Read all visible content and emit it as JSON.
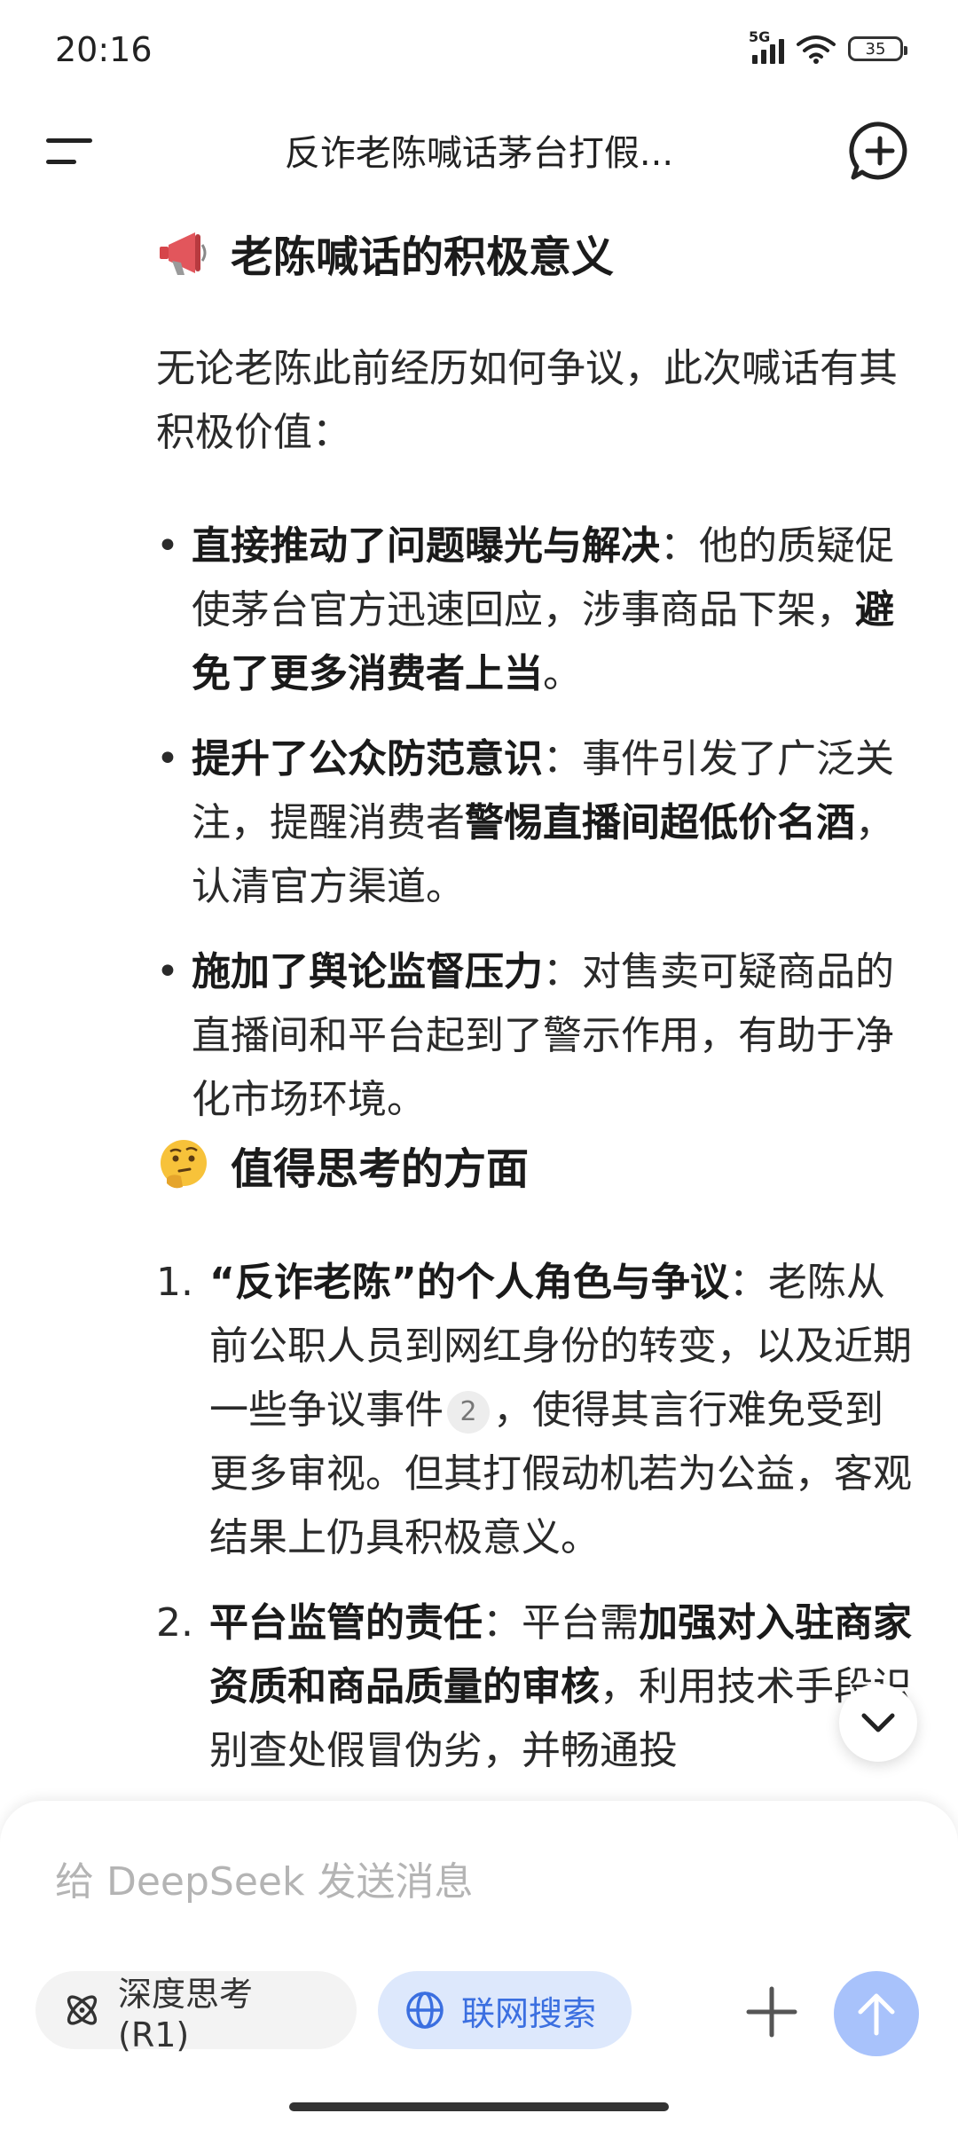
{
  "status_bar": {
    "time": "20:16",
    "network": "5G",
    "battery": "35"
  },
  "header": {
    "title": "反诈老陈喊话茅台打假..."
  },
  "section1": {
    "emoji": "megaphone-emoji",
    "heading": "老陈喊话的积极意义",
    "intro": "无论老陈此前经历如何争议，此次喊话有其积极价值：",
    "items": [
      {
        "bold": "直接推动了问题曝光与解决",
        "text1": "：他的质疑促使茅台官方迅速回应，涉事商品下架，",
        "bold2": "避免了更多消费者上当",
        "text2": "。"
      },
      {
        "bold": "提升了公众防范意识",
        "text1": "：事件引发了广泛关注，提醒消费者",
        "bold2": "警惕直播间超低价名酒",
        "text2": "，认清官方渠道。"
      },
      {
        "bold": "施加了舆论监督压力",
        "text1": "：对售卖可疑商品的直播间和平台起到了警示作用，有助于净化市场环境。"
      }
    ]
  },
  "section2": {
    "emoji": "thinking-face-emoji",
    "heading": "值得思考的方面",
    "items": [
      {
        "num": "1.",
        "bold": "“反诈老陈”的个人角色与争议",
        "text1": "：老陈从前公职人员到网红身份的转变，以及近期一些争议事件",
        "cite": "2",
        "text2": "，使得其言行难免受到更多审视。但其打假动机若为公益，客观结果上仍具积极意义。"
      },
      {
        "num": "2.",
        "bold": "平台监管的责任",
        "text1": "：平台需",
        "bold2": "加强对入驻商家资质和商品质量的审核",
        "text2": "，利用技术手段识别查处假冒伪劣，并畅通投"
      }
    ]
  },
  "composer": {
    "placeholder": "给 DeepSeek 发送消息",
    "deep_think_label": "深度思考 (R1)",
    "web_search_label": "联网搜索"
  },
  "colors": {
    "accent": "#3b6fe0",
    "send_bg": "#a8c2fb",
    "web_pill_bg": "#dde8fc"
  }
}
